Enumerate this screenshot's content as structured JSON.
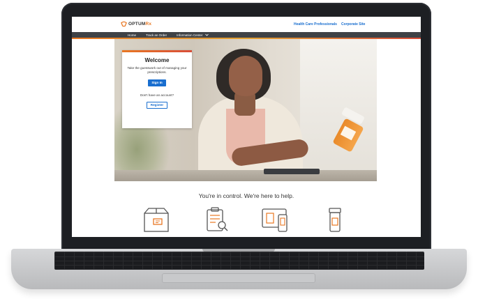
{
  "site": {
    "logo": {
      "brand": "OPTUM",
      "suffix": "Rx"
    },
    "header_links": [
      {
        "label": "Health Care Professionals"
      },
      {
        "label": "Corporate Site"
      }
    ],
    "nav": [
      {
        "label": "Home"
      },
      {
        "label": "Track an Order"
      },
      {
        "label": "Information Center"
      }
    ]
  },
  "welcome": {
    "title": "Welcome",
    "subtitle": "Take the guesswork out of managing your prescriptions.",
    "sign_in_label": "Sign In",
    "no_account_text": "Don't have an account?",
    "register_label": "Register"
  },
  "tagline": "You're in control. We're here to help.",
  "feature_icons": [
    {
      "icon": "package-icon"
    },
    {
      "icon": "clipboard-search-icon"
    },
    {
      "icon": "devices-icon"
    },
    {
      "icon": "pill-bottle-icon"
    }
  ],
  "colors": {
    "brand_orange": "#e87722",
    "link_blue": "#196ecf",
    "nav_bg": "#3f4246"
  }
}
